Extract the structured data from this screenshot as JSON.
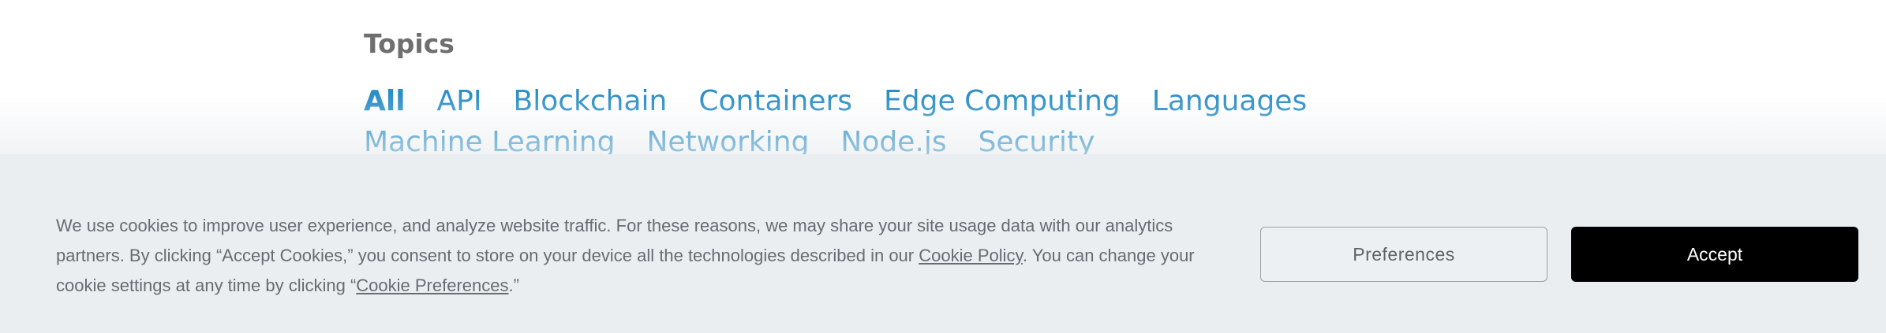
{
  "topics": {
    "title": "Topics",
    "items": [
      {
        "label": "All",
        "active": true
      },
      {
        "label": "API",
        "active": false
      },
      {
        "label": "Blockchain",
        "active": false
      },
      {
        "label": "Containers",
        "active": false
      },
      {
        "label": "Edge Computing",
        "active": false
      },
      {
        "label": "Languages",
        "active": false
      },
      {
        "label": "Machine Learning",
        "active": false
      },
      {
        "label": "Networking",
        "active": false
      },
      {
        "label": "Node.js",
        "active": false
      },
      {
        "label": "Security",
        "active": false
      }
    ]
  },
  "cookie_banner": {
    "text_part1": "We use cookies to improve user experience, and analyze website traffic. For these reasons, we may share your site usage data with our analytics partners. By clicking “Accept Cookies,” you consent to store on your device all the technologies described in our ",
    "cookie_policy_link": "Cookie Policy",
    "text_part2": ". You can change your cookie settings at any time by clicking “",
    "cookie_preferences_link": "Cookie Preferences",
    "text_part3": ".”",
    "preferences_button": "Preferences",
    "accept_button": "Accept"
  },
  "colors": {
    "link": "#2b8fc7",
    "banner_bg": "#ebeef0",
    "accept_bg": "#000000"
  }
}
